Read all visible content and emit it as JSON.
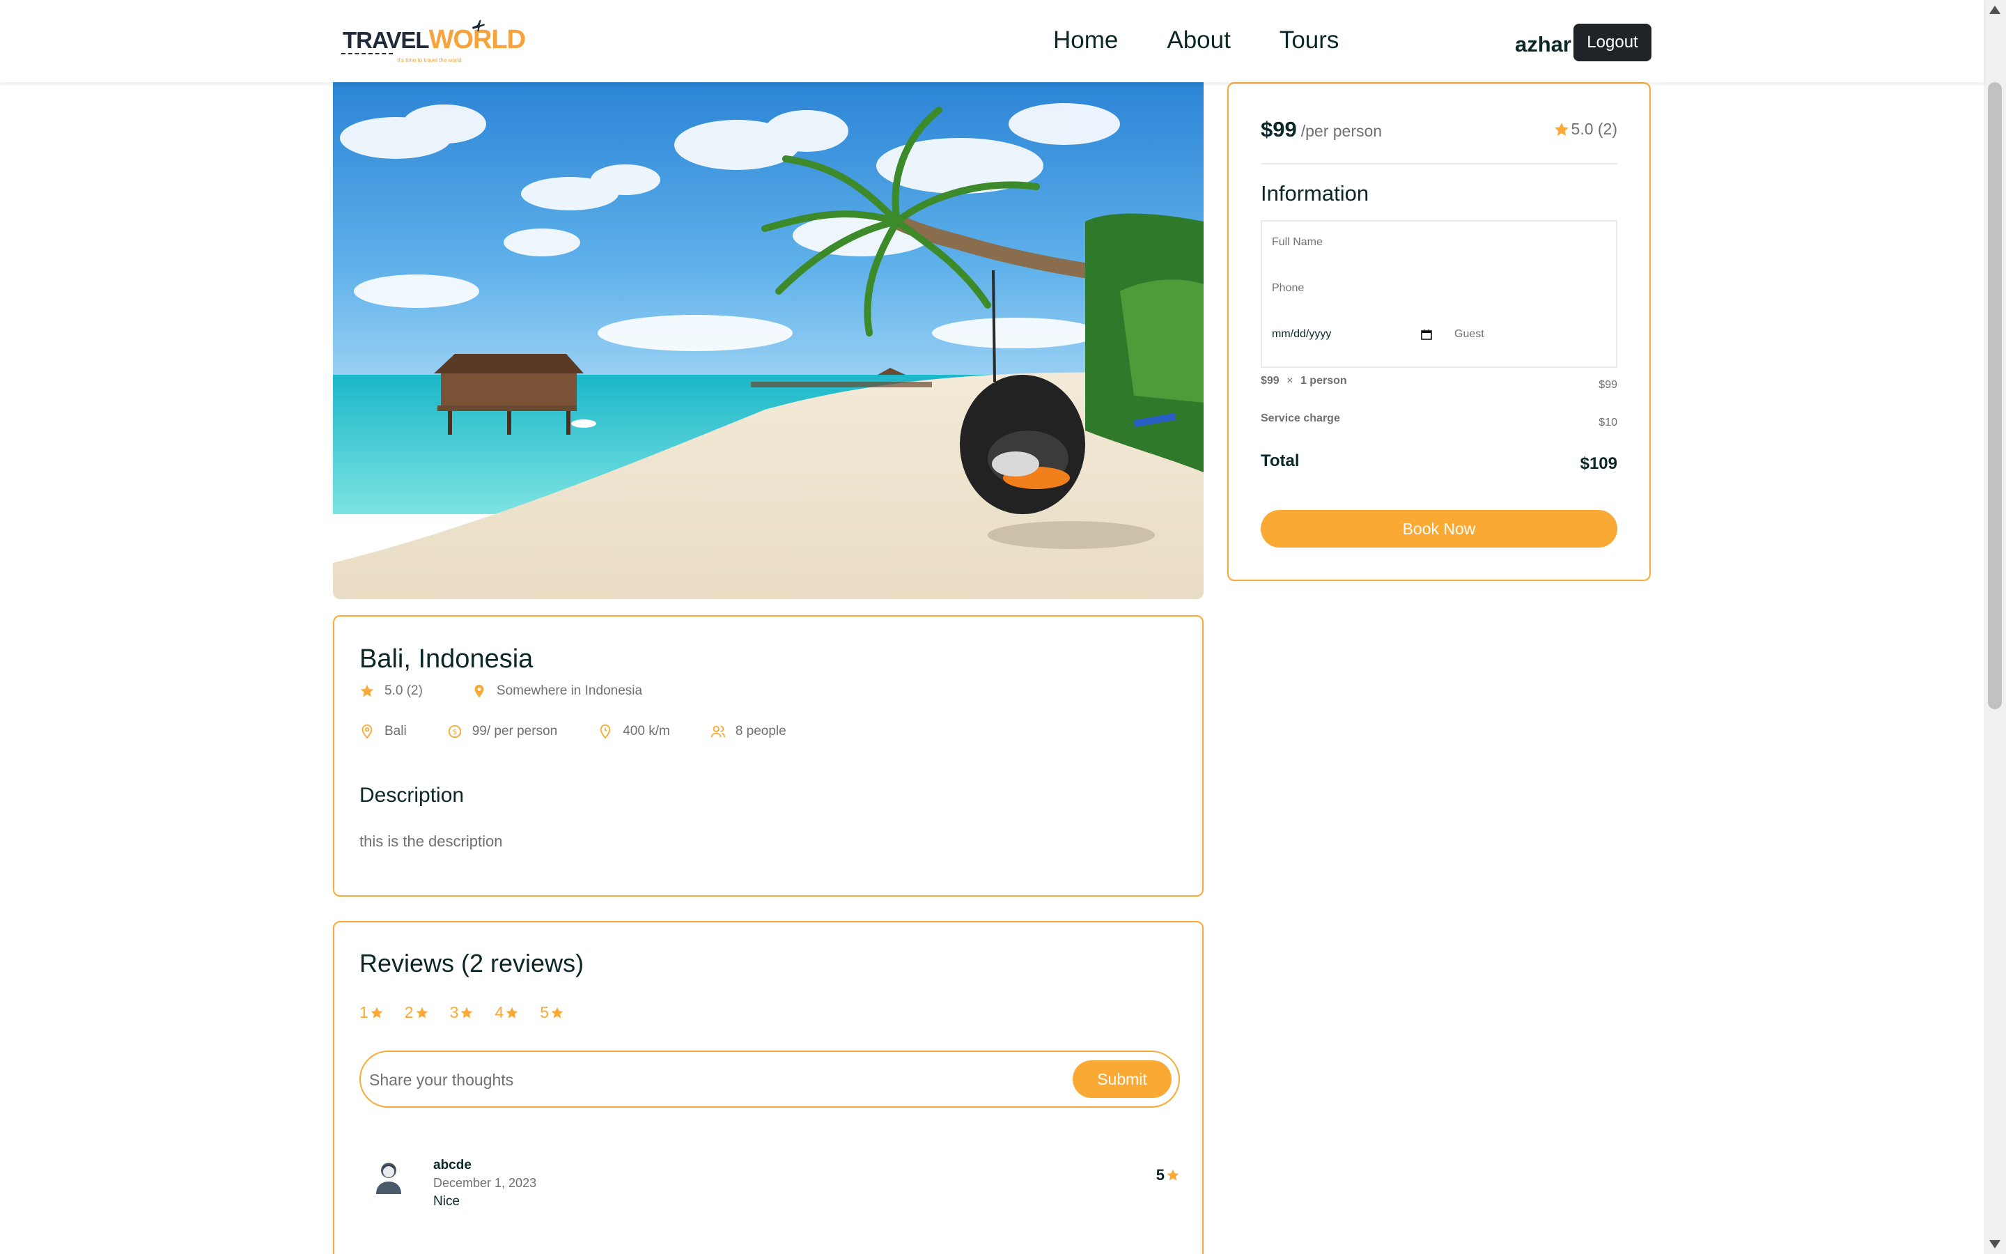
{
  "brand": {
    "name_part1": "TRAVEL",
    "name_part2": "WORLD",
    "tagline": "It's time to travel the world"
  },
  "nav": {
    "items": [
      {
        "label": "Home"
      },
      {
        "label": "About"
      },
      {
        "label": "Tours"
      }
    ]
  },
  "user": {
    "name": "azhar",
    "logout_label": "Logout"
  },
  "tour": {
    "title": "Bali, Indonesia",
    "rating": "5.0 (2)",
    "address": "Somewhere in Indonesia",
    "city": "Bali",
    "price": "99/ per person",
    "distance": "400 k/m",
    "max_group": "8 people",
    "description_heading": "Description",
    "description": "this is the description"
  },
  "reviews": {
    "title": "Reviews (2 reviews)",
    "rating_options": [
      "1",
      "2",
      "3",
      "4",
      "5"
    ],
    "input_placeholder": "Share your thoughts",
    "submit_label": "Submit",
    "items": [
      {
        "username": "abcde",
        "date": "December 1, 2023",
        "text": "Nice",
        "rating": "5"
      }
    ]
  },
  "booking": {
    "price": "$99",
    "per_person": "/per person",
    "rating": "5.0 (2)",
    "info_heading": "Information",
    "fullname_placeholder": "Full Name",
    "phone_placeholder": "Phone",
    "date_placeholder": "mm/dd/yyyy",
    "guest_placeholder": "Guest",
    "line_price_label": "$99",
    "line_times": "×",
    "line_person": "1 person",
    "line_price_value": "$99",
    "service_label": "Service charge",
    "service_value": "$10",
    "total_label": "Total",
    "total_value": "$109",
    "book_label": "Book Now"
  },
  "colors": {
    "accent": "#faa935",
    "heading": "#0b2727",
    "text_muted": "#6e7074",
    "dark_button": "#202428"
  }
}
